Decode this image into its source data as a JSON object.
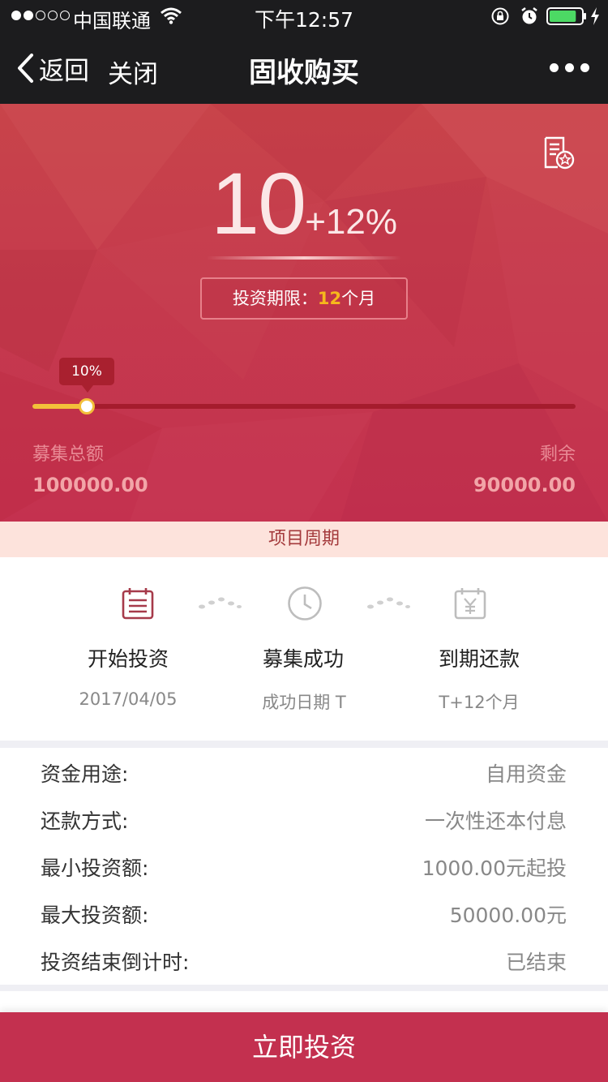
{
  "status_bar": {
    "carrier": "中国联通",
    "time": "下午12:57",
    "signal_strength": 2,
    "battery_level": 0.85
  },
  "nav": {
    "back_label": "返回",
    "close_label": "关闭",
    "title": "固收购买"
  },
  "hero": {
    "rate_base": "10",
    "rate_extra": "+12%",
    "term_label": "投资期限：",
    "term_value": "12",
    "term_unit": "个月",
    "progress_label": "10%",
    "progress_fraction": 0.1,
    "total_label": "募集总额",
    "total_value": "100000.00",
    "remain_label": "剩余",
    "remain_value": "90000.00",
    "colors": {
      "accent": "#c3304f",
      "progress": "#f3c03a",
      "term_highlight": "#f6b81c"
    }
  },
  "cycle": {
    "header": "项目周期",
    "steps": [
      {
        "icon": "calendar-icon",
        "title": "开始投资",
        "sub": "2017/04/05"
      },
      {
        "icon": "clock-icon",
        "title": "募集成功",
        "sub": "成功日期 T"
      },
      {
        "icon": "calendar-yen-icon",
        "title": "到期还款",
        "sub": "T+12个月"
      }
    ]
  },
  "info": {
    "rows": [
      {
        "label": "资金用途:",
        "value": "自用资金"
      },
      {
        "label": "还款方式:",
        "value": "一次性还本付息"
      },
      {
        "label": "最小投资额:",
        "value": "1000.00元起投"
      },
      {
        "label": "最大投资额:",
        "value": "50000.00元"
      },
      {
        "label": "投资结束倒计时:",
        "value": "已结束"
      }
    ]
  },
  "footer": {
    "button_label": "立即投资"
  }
}
